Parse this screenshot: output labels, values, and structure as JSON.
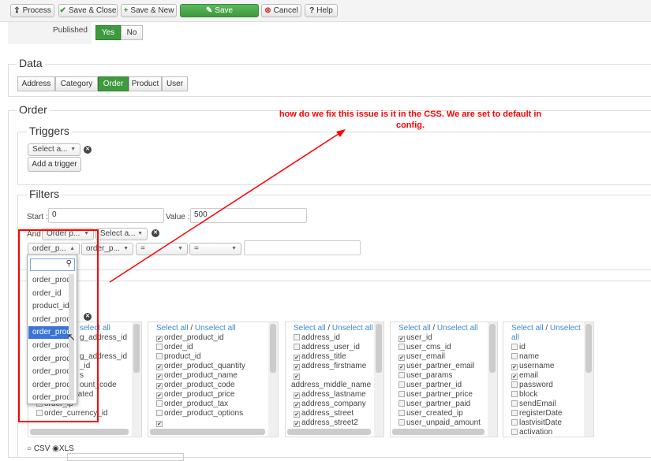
{
  "toolbar": {
    "process": "Process",
    "save_close": "Save & Close",
    "save_new": "Save & New",
    "save": "Save",
    "cancel": "Cancel",
    "help": "Help"
  },
  "published": {
    "label": "Published",
    "yes": "Yes",
    "no": "No"
  },
  "data_section": {
    "title": "Data",
    "tabs": [
      "Address",
      "Category",
      "Order",
      "Product",
      "User"
    ],
    "active": "Order"
  },
  "order_section": {
    "title": "Order"
  },
  "triggers": {
    "title": "Triggers",
    "select": "Select a...",
    "add": "Add a trigger"
  },
  "filters": {
    "title": "Filters",
    "start_label": "Start :",
    "start_value": "0",
    "value_label": "Value :",
    "value_value": "500",
    "and_label": "And",
    "and_select1": "Order p...",
    "and_select2": "Select a...",
    "row_select1": "order_p...",
    "row_select2": "order_p...",
    "row_op1": "=",
    "row_op2": "="
  },
  "dropdown": {
    "items": [
      "order_prod",
      "order_id",
      "product_id",
      "order_prod",
      "order_prod",
      "order_prod",
      "order_prod",
      "order_prod",
      "order_prod",
      "order_prod"
    ],
    "highlighted_index": 4
  },
  "columns": {
    "select_all": "Select all",
    "unselect_all": "Unselect all",
    "col1": [
      {
        "t": "select all",
        "link": true
      },
      {
        "t": "g_address_id"
      },
      {
        "t": ""
      },
      {
        "t": "g_address_id"
      },
      {
        "t": "_id"
      },
      {
        "t": "s"
      },
      {
        "t": "ount_code"
      },
      {
        "t": "order_created",
        "c": true
      },
      {
        "t": "order_ip",
        "c": false
      },
      {
        "t": "order_currency_id",
        "c": false
      }
    ],
    "col2": [
      {
        "t": "order_product_id",
        "c": true
      },
      {
        "t": "order_id",
        "c": false
      },
      {
        "t": "product_id",
        "c": false
      },
      {
        "t": "order_product_quantity",
        "c": true
      },
      {
        "t": "order_product_name",
        "c": true
      },
      {
        "t": "order_product_code",
        "c": true
      },
      {
        "t": "order_product_price",
        "c": true
      },
      {
        "t": "order_product_tax",
        "c": false
      },
      {
        "t": "order_product_options",
        "c": false
      },
      {
        "t": "",
        "c": true
      }
    ],
    "col3": [
      {
        "t": "address_id",
        "c": false
      },
      {
        "t": "address_user_id",
        "c": false
      },
      {
        "t": "address_title",
        "c": true
      },
      {
        "t": "address_firstname",
        "c": true
      },
      {
        "t": "",
        "c": true
      },
      {
        "t": "address_middle_name",
        "nocb": true
      },
      {
        "t": "address_lastname",
        "c": true
      },
      {
        "t": "address_company",
        "c": true
      },
      {
        "t": "address_street",
        "c": true
      },
      {
        "t": "address_street2",
        "c": true
      }
    ],
    "col4": [
      {
        "t": "user_id",
        "c": true
      },
      {
        "t": "user_cms_id",
        "c": false
      },
      {
        "t": "user_email",
        "c": true
      },
      {
        "t": "user_partner_email",
        "c": true
      },
      {
        "t": "user_params",
        "c": false
      },
      {
        "t": "user_partner_id",
        "c": false
      },
      {
        "t": "user_partner_price",
        "c": false
      },
      {
        "t": "user_partner_paid",
        "c": false
      },
      {
        "t": "user_created_ip",
        "c": false
      },
      {
        "t": "user_unpaid_amount",
        "c": false
      }
    ],
    "col5": [
      {
        "t": "id",
        "c": false
      },
      {
        "t": "name",
        "c": false
      },
      {
        "t": "username",
        "c": true
      },
      {
        "t": "email",
        "c": true
      },
      {
        "t": "password",
        "c": false
      },
      {
        "t": "block",
        "c": false
      },
      {
        "t": "sendEmail",
        "c": false
      },
      {
        "t": "registerDate",
        "c": false
      },
      {
        "t": "lastvisitDate",
        "c": false
      },
      {
        "t": "activation",
        "c": false
      }
    ]
  },
  "format": {
    "csv": "CSV",
    "xls": "XLS",
    "selected": "XLS"
  },
  "annotation": {
    "text": "how do we fix this issue is it in the CSS. We are set to default in config.",
    "color": "#ff0000"
  }
}
